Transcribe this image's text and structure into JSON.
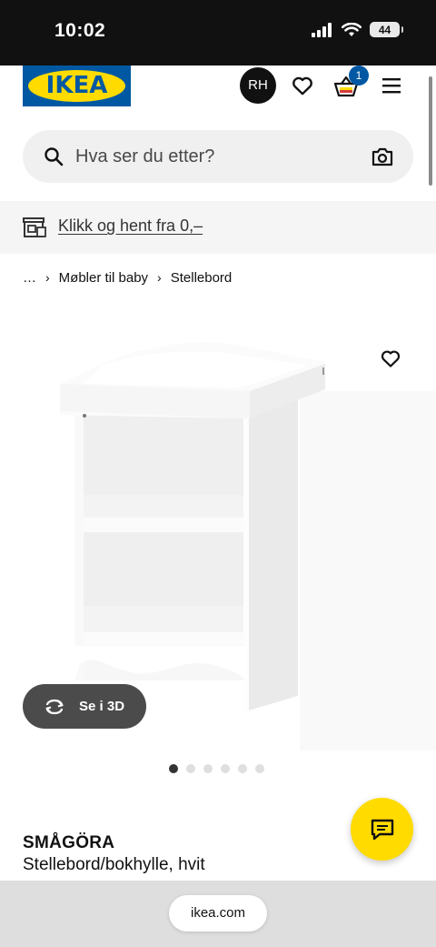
{
  "status_bar": {
    "time": "10:02",
    "battery": "44"
  },
  "header": {
    "logo_text": "IKEA",
    "avatar_initials": "RH",
    "cart_count": "1"
  },
  "search": {
    "placeholder": "Hva ser du etter?"
  },
  "pickup": {
    "label": "Klikk og hent fra 0,–"
  },
  "breadcrumb": {
    "ellipsis": "…",
    "items": [
      "Møbler til baby",
      "Stellebord"
    ]
  },
  "gallery": {
    "view_3d_label": "Se i 3D",
    "image_count": 6,
    "active_index": 0
  },
  "product": {
    "name": "SMÅGÖRA",
    "description": "Stellebord/bokhylle, hvit"
  },
  "browser": {
    "url": "ikea.com"
  },
  "colors": {
    "brand_blue": "#0058a3",
    "brand_yellow": "#ffdb00",
    "dark": "#111111"
  }
}
